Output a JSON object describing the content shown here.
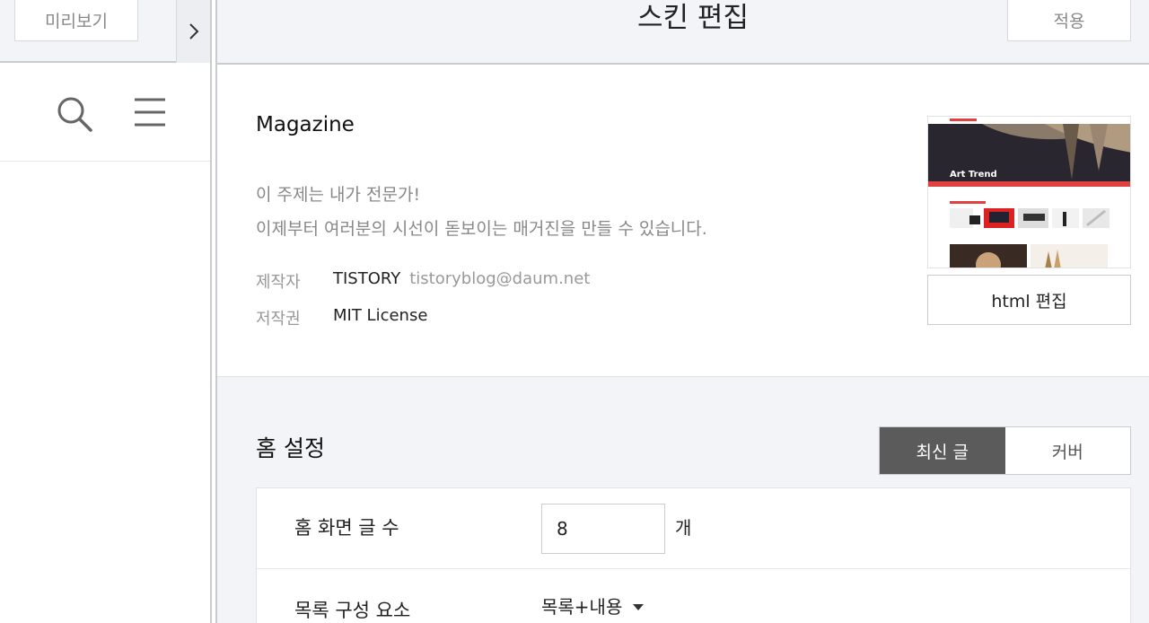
{
  "left_panel": {
    "preview_label": "미리보기"
  },
  "header": {
    "title": "스킨 편집",
    "apply_label": "적용"
  },
  "skin": {
    "name": "Magazine",
    "description_line1": "이 주제는 내가 전문가!",
    "description_line2": "이제부터 여러분의 시선이 돋보이는 매거진을 만들 수 있습니다.",
    "author_label": "제작자",
    "author_name": "TISTORY",
    "author_email": "tistoryblog@daum.net",
    "license_label": "저작권",
    "license_value": "MIT License",
    "thumbnail_title": "Art Trend",
    "html_edit_label": "html 편집"
  },
  "home_settings": {
    "title": "홈 설정",
    "toggle_latest": "최신 글",
    "toggle_cover": "커버",
    "post_count_label": "홈 화면 글 수",
    "post_count_value": "8",
    "post_count_unit": "개",
    "list_label": "목록 구성 요소",
    "list_value": "목록+내용"
  },
  "colors": {
    "accent_dark": "#5b5b5b",
    "background": "#f3f4f7"
  }
}
